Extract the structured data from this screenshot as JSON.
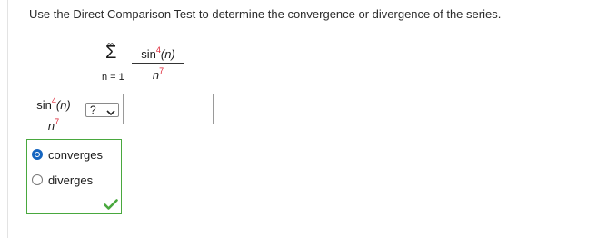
{
  "question": {
    "prompt": "Use the Direct Comparison Test to determine the convergence or divergence of the series."
  },
  "series": {
    "upper_limit": "∞",
    "lower_limit": "n = 1",
    "numerator_fn": "sin",
    "numerator_exp": "4",
    "numerator_arg": "(n)",
    "denominator_base": "n",
    "denominator_exp": "7"
  },
  "comparison": {
    "lhs_numerator_fn": "sin",
    "lhs_numerator_exp": "4",
    "lhs_numerator_arg": "(n)",
    "lhs_denominator_base": "n",
    "lhs_denominator_exp": "7",
    "operator_select_value": "?",
    "answer_input_value": ""
  },
  "options": [
    {
      "label": "converges",
      "selected": true
    },
    {
      "label": "diverges",
      "selected": false
    }
  ],
  "status": {
    "correct_icon": "check-icon",
    "colors": {
      "correct": "#49a83e",
      "accent": "#1565c0",
      "exponent": "#dd2222"
    }
  }
}
